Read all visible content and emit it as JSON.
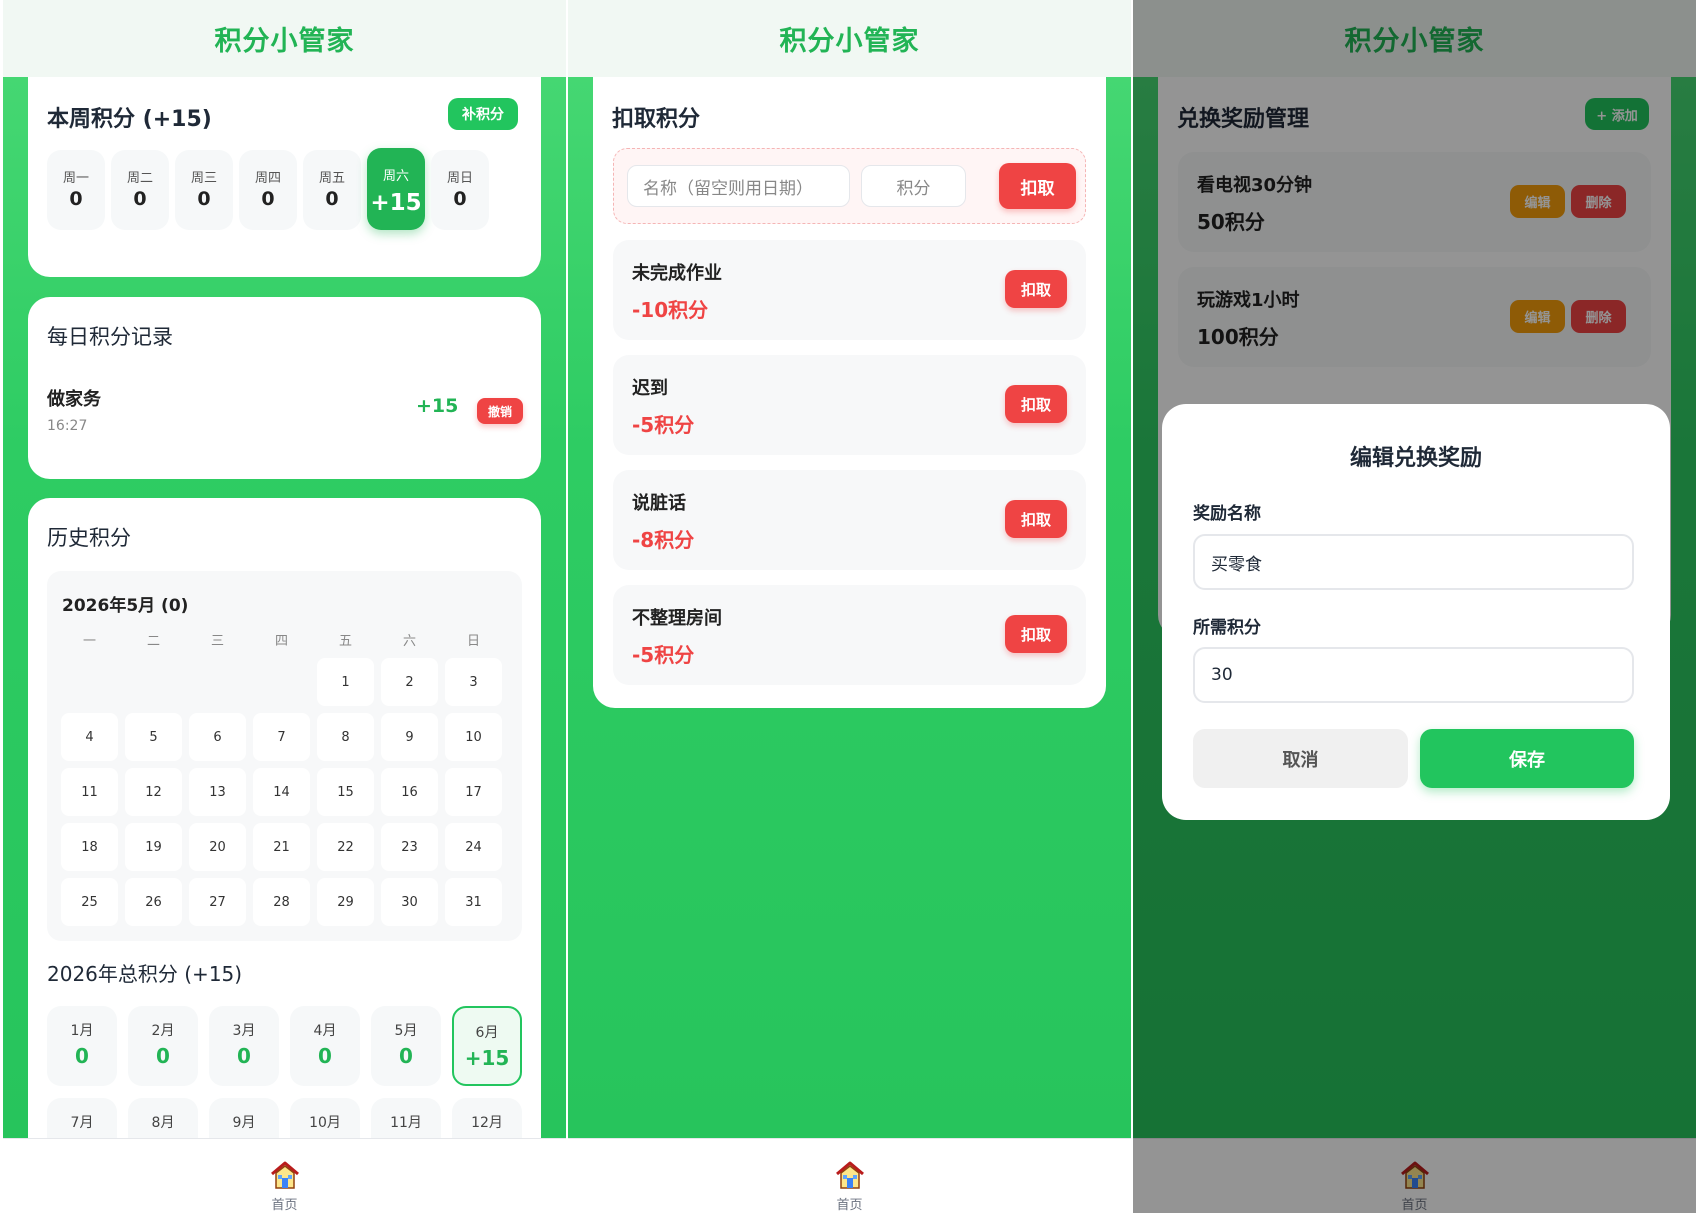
{
  "app_title": "积分小管家",
  "nav_home_label": "首页",
  "panel1": {
    "weekly": {
      "title": "本周积分 (+15)",
      "add_button": "补积分",
      "days": [
        {
          "name": "周一",
          "value": "0",
          "active": false
        },
        {
          "name": "周二",
          "value": "0",
          "active": false
        },
        {
          "name": "周三",
          "value": "0",
          "active": false
        },
        {
          "name": "周四",
          "value": "0",
          "active": false
        },
        {
          "name": "周五",
          "value": "0",
          "active": false
        },
        {
          "name": "周六",
          "value": "+15",
          "active": true
        },
        {
          "name": "周日",
          "value": "0",
          "active": false
        }
      ]
    },
    "daily": {
      "title": "每日积分记录",
      "records": [
        {
          "name": "做家务",
          "time": "16:27",
          "points": "+15",
          "undo_label": "撤销"
        }
      ]
    },
    "history": {
      "title": "历史积分",
      "calendar_title": "2026年5月 (0)",
      "weekday_headers": [
        "一",
        "二",
        "三",
        "四",
        "五",
        "六",
        "日"
      ],
      "calendar_weeks": [
        [
          "",
          "",
          "",
          "",
          "1",
          "2",
          "3"
        ],
        [
          "4",
          "5",
          "6",
          "7",
          "8",
          "9",
          "10"
        ],
        [
          "11",
          "12",
          "13",
          "14",
          "15",
          "16",
          "17"
        ],
        [
          "18",
          "19",
          "20",
          "21",
          "22",
          "23",
          "24"
        ],
        [
          "25",
          "26",
          "27",
          "28",
          "29",
          "30",
          "31"
        ]
      ],
      "year_title": "2026年总积分 (+15)",
      "months": [
        {
          "name": "1月",
          "value": "0",
          "active": false
        },
        {
          "name": "2月",
          "value": "0",
          "active": false
        },
        {
          "name": "3月",
          "value": "0",
          "active": false
        },
        {
          "name": "4月",
          "value": "0",
          "active": false
        },
        {
          "name": "5月",
          "value": "0",
          "active": false
        },
        {
          "name": "6月",
          "value": "+15",
          "active": true
        },
        {
          "name": "7月",
          "value": "",
          "active": false
        },
        {
          "name": "8月",
          "value": "",
          "active": false
        },
        {
          "name": "9月",
          "value": "",
          "active": false
        },
        {
          "name": "10月",
          "value": "",
          "active": false
        },
        {
          "name": "11月",
          "value": "",
          "active": false
        },
        {
          "name": "12月",
          "value": "",
          "active": false
        }
      ]
    }
  },
  "panel2": {
    "title": "扣取积分",
    "name_placeholder": "名称（留空则用日期）",
    "points_placeholder": "积分",
    "deduct_button": "扣取",
    "items": [
      {
        "name": "未完成作业",
        "points": "-10积分",
        "button": "扣取"
      },
      {
        "name": "迟到",
        "points": "-5积分",
        "button": "扣取"
      },
      {
        "name": "说脏话",
        "points": "-8积分",
        "button": "扣取"
      },
      {
        "name": "不整理房间",
        "points": "-5积分",
        "button": "扣取"
      }
    ]
  },
  "panel3": {
    "title": "兑换奖励管理",
    "add_button": "+ 添加",
    "rewards": [
      {
        "name": "看电视30分钟",
        "cost": "50积分",
        "edit": "编辑",
        "delete": "删除"
      },
      {
        "name": "玩游戏1小时",
        "cost": "100积分",
        "edit": "编辑",
        "delete": "删除"
      }
    ],
    "modal": {
      "title": "编辑兑换奖励",
      "name_label": "奖励名称",
      "name_value": "买零食",
      "cost_label": "所需积分",
      "cost_value": "30",
      "cancel_button": "取消",
      "save_button": "保存"
    }
  },
  "colors": {
    "brand_green": "#22b455",
    "danger_red": "#ef4444",
    "warning_orange": "#f59e0b"
  }
}
